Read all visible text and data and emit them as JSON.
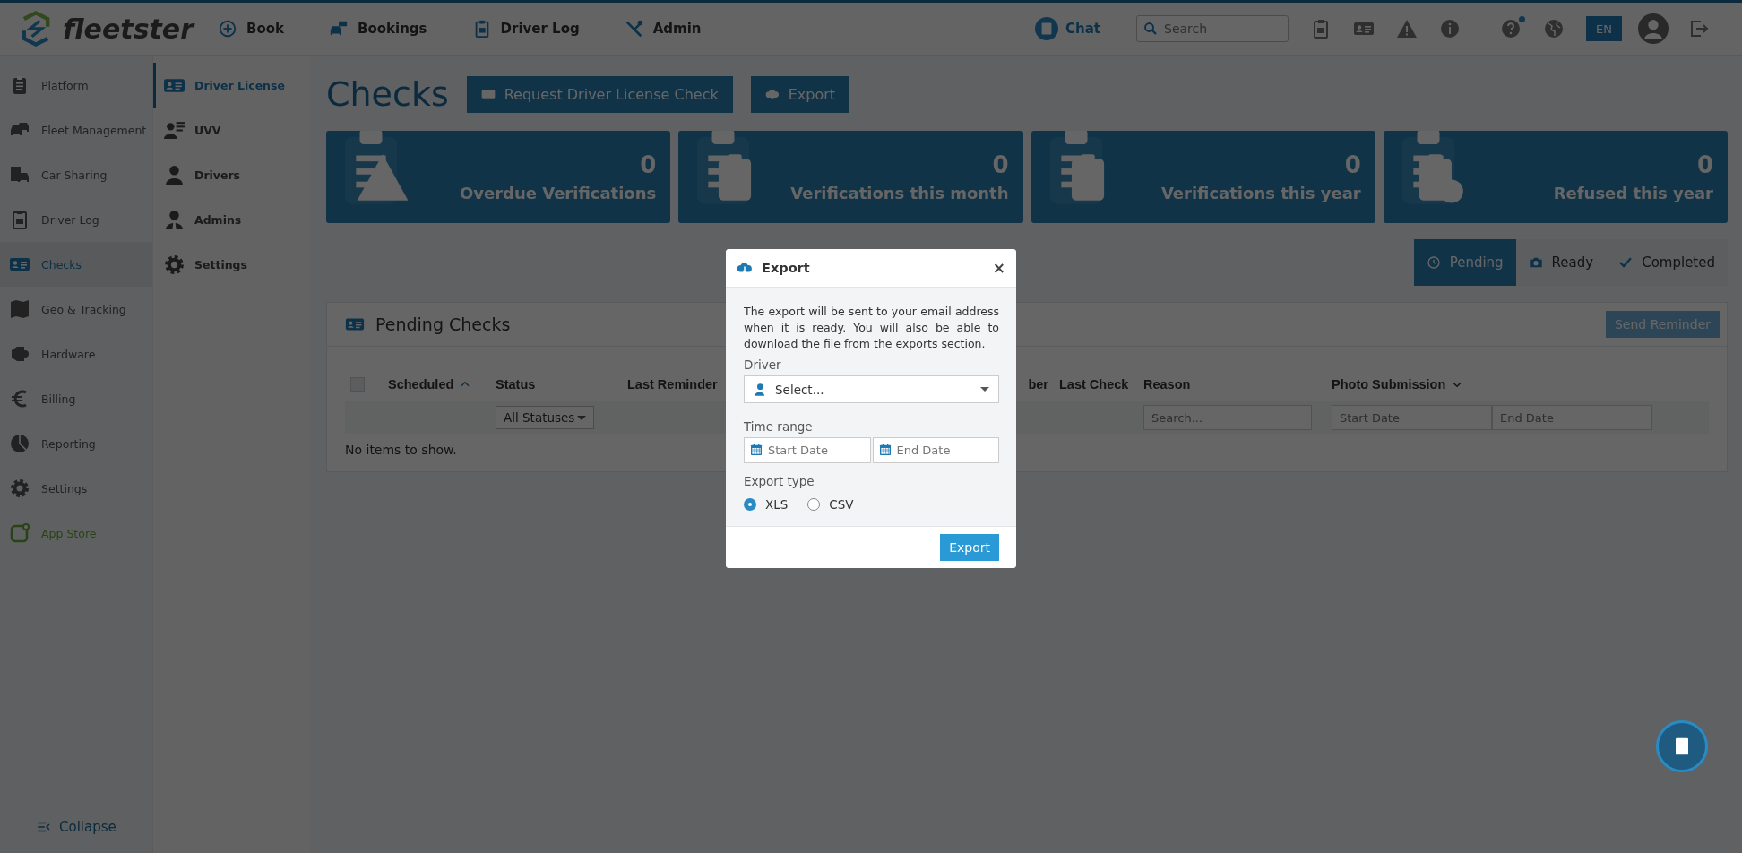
{
  "topbar": {
    "logo": "fleetster",
    "nav": [
      {
        "label": "Book"
      },
      {
        "label": "Bookings"
      },
      {
        "label": "Driver Log"
      },
      {
        "label": "Admin"
      }
    ],
    "chat": "Chat",
    "search": {
      "placeholder": "Search"
    },
    "help_badge": true,
    "language": "EN"
  },
  "sidebar": {
    "items": [
      {
        "label": "Platform",
        "selected": false,
        "kind": "module"
      },
      {
        "label": "Fleet Management",
        "selected": false,
        "kind": "module"
      },
      {
        "label": "Car Sharing",
        "selected": false,
        "kind": "module"
      },
      {
        "label": "Driver Log",
        "selected": false,
        "kind": "module"
      },
      {
        "label": "Checks",
        "selected": true,
        "kind": "module"
      },
      {
        "label": "Geo & Tracking",
        "selected": false,
        "kind": "module"
      },
      {
        "label": "Hardware",
        "selected": false,
        "kind": "module"
      },
      {
        "label": "Billing",
        "selected": false,
        "kind": "module"
      },
      {
        "label": "Reporting",
        "selected": false,
        "kind": "module"
      },
      {
        "label": "Settings",
        "selected": false,
        "kind": "module"
      },
      {
        "label": "App Store",
        "selected": false,
        "kind": "store"
      }
    ],
    "collapse": "Collapse"
  },
  "subnav": {
    "items": [
      {
        "label": "Driver License",
        "selected": true
      },
      {
        "label": "UVV",
        "selected": false
      },
      {
        "label": "Drivers",
        "selected": false
      },
      {
        "label": "Admins",
        "selected": false
      },
      {
        "label": "Settings",
        "selected": false
      }
    ]
  },
  "page": {
    "title": "Checks",
    "actions": [
      "Request Driver License Check",
      "Export"
    ]
  },
  "stats": [
    {
      "value": "0",
      "label": "Overdue Verifications",
      "kind": "warning"
    },
    {
      "value": "0",
      "label": "Verifications this month",
      "kind": "clipboard"
    },
    {
      "value": "0",
      "label": "Verifications this year",
      "kind": "clipboard"
    },
    {
      "value": "0",
      "label": "Refused this year",
      "kind": "refused"
    }
  ],
  "tabs": [
    {
      "label": "Pending",
      "selected": true
    },
    {
      "label": "Ready",
      "selected": false
    },
    {
      "label": "Completed",
      "selected": false
    }
  ],
  "panel": {
    "title": "Pending Checks",
    "send_reminder": {
      "label": "Send Reminder",
      "disabled": true
    },
    "select_all": {
      "checked": false
    },
    "columns": [
      {
        "label": "Scheduled",
        "sorted": true,
        "menu": false
      },
      {
        "label": "Status",
        "sorted": false,
        "menu": false
      },
      {
        "label": "Last Reminder",
        "sorted": false,
        "menu": false
      },
      {
        "label": "ber",
        "sorted": false,
        "menu": false
      },
      {
        "label": "Last Check",
        "sorted": false,
        "menu": false
      },
      {
        "label": "Reason",
        "sorted": false,
        "menu": false
      },
      {
        "label": "Photo Submission",
        "sorted": false,
        "menu": true
      }
    ],
    "filters": {
      "status": "All Statuses",
      "reason_placeholder": "Search...",
      "start_placeholder": "Start Date",
      "end_placeholder": "End Date"
    },
    "empty": "No items to show."
  },
  "modal": {
    "title": "Export",
    "close": "×",
    "message": "The export will be sent to your email address when it is ready. You will also be able to download the file from the exports section.",
    "driver": {
      "label": "Driver",
      "placeholder": "Select..."
    },
    "time_range": {
      "label": "Time range",
      "start_placeholder": "Start Date",
      "end_placeholder": "End Date"
    },
    "export_type": {
      "label": "Export type",
      "options": [
        {
          "label": "XLS",
          "selected": true
        },
        {
          "label": "CSV",
          "selected": false
        }
      ]
    },
    "button": "Export"
  }
}
